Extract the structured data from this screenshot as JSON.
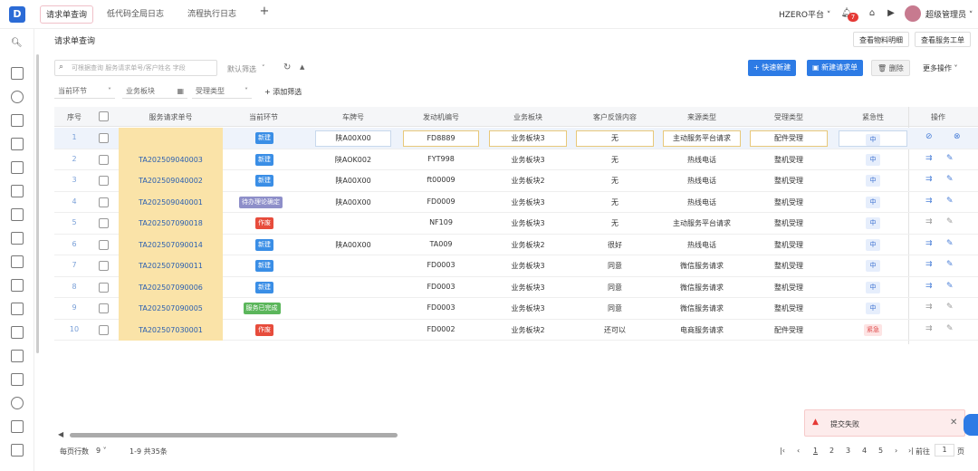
{
  "topbar": {
    "logo": "D",
    "tabs": [
      {
        "label": "请求单查询",
        "active": true
      },
      {
        "label": "低代码全局日志",
        "active": false
      },
      {
        "label": "流程执行日志",
        "active": false
      }
    ],
    "add_tab": "+",
    "platform": "HZERO平台",
    "notification_count": "7",
    "username": "超级管理员"
  },
  "header": {
    "title": "请求单查询",
    "btn_material": "查看物料明细",
    "btn_service": "查看服务工单"
  },
  "toolbar": {
    "search_placeholder": "可根据查询 服务请求单号/客户姓名 字段",
    "default_filter": "默认筛选",
    "btn_quick_new": "快速新建",
    "btn_new_request": "新建请求单",
    "btn_delete": "删除",
    "btn_more": "更多操作"
  },
  "filters": {
    "current_stage": "当前环节",
    "business_block": "业务板块",
    "accept_type": "受理类型",
    "add_filter": "添加筛选"
  },
  "table": {
    "columns": [
      "序号",
      "服务请求单号",
      "当前环节",
      "车牌号",
      "发动机编号",
      "业务板块",
      "客户反馈内容",
      "来源类型",
      "受理类型",
      "紧急性",
      "操作"
    ],
    "rows": [
      {
        "idx": "1",
        "reqno": "",
        "stage": "新建",
        "stage_color": "blue",
        "plate": "陕A00X00",
        "engine": "FD8889",
        "block": "业务板块3",
        "feedback": "无",
        "source": "主动服务平台请求",
        "accept": "配件受理",
        "urgency": "中",
        "urgency_level": "mid",
        "editing": true
      },
      {
        "idx": "2",
        "reqno": "TA202509040003",
        "stage": "新建",
        "stage_color": "blue",
        "plate": "陕AOK002",
        "engine": "FYT998",
        "block": "业务板块3",
        "feedback": "无",
        "source": "热线电话",
        "accept": "整机受理",
        "urgency": "中",
        "urgency_level": "mid"
      },
      {
        "idx": "3",
        "reqno": "TA202509040002",
        "stage": "新建",
        "stage_color": "blue",
        "plate": "陕A00X00",
        "engine": "ft00009",
        "block": "业务板块2",
        "feedback": "无",
        "source": "热线电话",
        "accept": "整机受理",
        "urgency": "中",
        "urgency_level": "mid"
      },
      {
        "idx": "4",
        "reqno": "TA202509040001",
        "stage": "待办理论确定",
        "stage_color": "purple",
        "plate": "陕A00X00",
        "engine": "FD0009",
        "block": "业务板块3",
        "feedback": "无",
        "source": "热线电话",
        "accept": "整机受理",
        "urgency": "中",
        "urgency_level": "mid"
      },
      {
        "idx": "5",
        "reqno": "TA202507090018",
        "stage": "作废",
        "stage_color": "red",
        "plate": "",
        "engine": "NF109",
        "block": "业务板块3",
        "feedback": "无",
        "source": "主动服务平台请求",
        "accept": "整机受理",
        "urgency": "中",
        "urgency_level": "mid"
      },
      {
        "idx": "6",
        "reqno": "TA202507090014",
        "stage": "新建",
        "stage_color": "blue",
        "plate": "陕A00X00",
        "engine": "TA009",
        "block": "业务板块2",
        "feedback": "很好",
        "source": "热线电话",
        "accept": "整机受理",
        "urgency": "中",
        "urgency_level": "mid"
      },
      {
        "idx": "7",
        "reqno": "TA202507090011",
        "stage": "新建",
        "stage_color": "blue",
        "plate": "",
        "engine": "FD0003",
        "block": "业务板块3",
        "feedback": "同意",
        "source": "微信服务请求",
        "accept": "整机受理",
        "urgency": "中",
        "urgency_level": "mid"
      },
      {
        "idx": "8",
        "reqno": "TA202507090006",
        "stage": "新建",
        "stage_color": "blue",
        "plate": "",
        "engine": "FD0003",
        "block": "业务板块3",
        "feedback": "同意",
        "source": "微信服务请求",
        "accept": "整机受理",
        "urgency": "中",
        "urgency_level": "mid"
      },
      {
        "idx": "9",
        "reqno": "TA202507090005",
        "stage": "服务已完成",
        "stage_color": "green",
        "plate": "",
        "engine": "FD0003",
        "block": "业务板块3",
        "feedback": "同意",
        "source": "微信服务请求",
        "accept": "整机受理",
        "urgency": "中",
        "urgency_level": "mid"
      },
      {
        "idx": "10",
        "reqno": "TA202507030001",
        "stage": "作废",
        "stage_color": "red",
        "plate": "",
        "engine": "FD0002",
        "block": "业务板块2",
        "feedback": "还可以",
        "source": "电商服务请求",
        "accept": "配件受理",
        "urgency": "紧急",
        "urgency_level": "hi"
      }
    ]
  },
  "footer": {
    "rows_per_page_label": "每页行数",
    "rows_per_page": "9",
    "range": "1-9 共35条",
    "pages": [
      "1",
      "2",
      "3",
      "4",
      "5"
    ],
    "goto_label": "前往",
    "goto_value": "1",
    "page_unit": "页"
  },
  "toast": {
    "message": "提交失败"
  }
}
